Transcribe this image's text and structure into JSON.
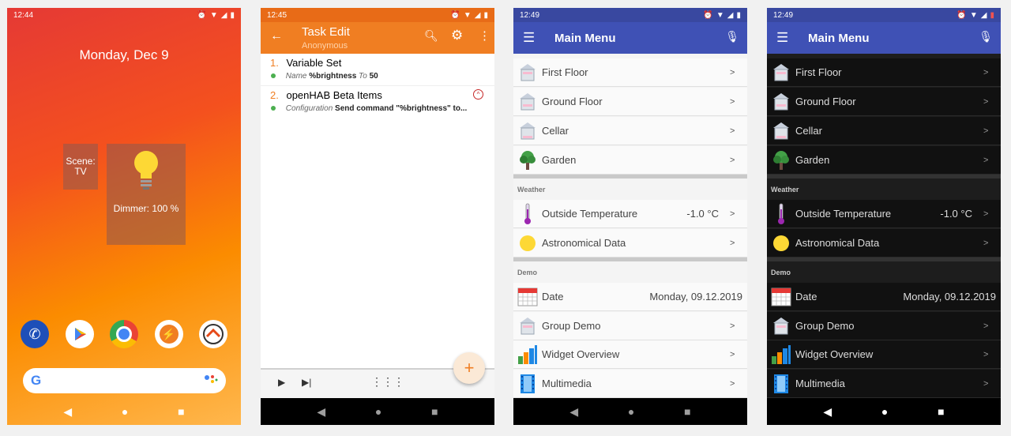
{
  "phone1": {
    "status_time": "12:44",
    "date": "Monday, Dec 9",
    "scene_widget": {
      "line1": "Scene:",
      "line2": "TV"
    },
    "dimmer_widget": {
      "label": "Dimmer: 100 %"
    },
    "dock_apps": [
      "phone-icon",
      "play-store-icon",
      "chrome-icon",
      "tasker-icon",
      "openhab-icon"
    ]
  },
  "phone2": {
    "status_time": "12:45",
    "title": "Task Edit",
    "subtitle": "Anonymous",
    "tasks": [
      {
        "num": "1.",
        "name": "Variable Set",
        "k1": "Name",
        "v1": "%brightness",
        "k2": "To",
        "v2": "50"
      },
      {
        "num": "2.",
        "name": "openHAB Beta Items",
        "k1": "Configuration",
        "v1": "Send command \"%brightness\" to..."
      }
    ],
    "fab": "+"
  },
  "main_menu": {
    "status_time": "12:49",
    "title": "Main Menu",
    "floors": [
      "First Floor",
      "Ground Floor",
      "Cellar",
      "Garden"
    ],
    "weather_header": "Weather",
    "weather": [
      {
        "label": "Outside Temperature",
        "value": "-1.0 °C"
      },
      {
        "label": "Astronomical Data",
        "value": ""
      }
    ],
    "demo_header": "Demo",
    "demo": [
      {
        "label": "Date",
        "value": "Monday, 09.12.2019"
      },
      {
        "label": "Group Demo",
        "value": ""
      },
      {
        "label": "Widget Overview",
        "value": ""
      },
      {
        "label": "Multimedia",
        "value": ""
      }
    ]
  },
  "colors": {
    "tasker_orange": "#f07e22",
    "openhab_indigo": "#3f51b5"
  }
}
